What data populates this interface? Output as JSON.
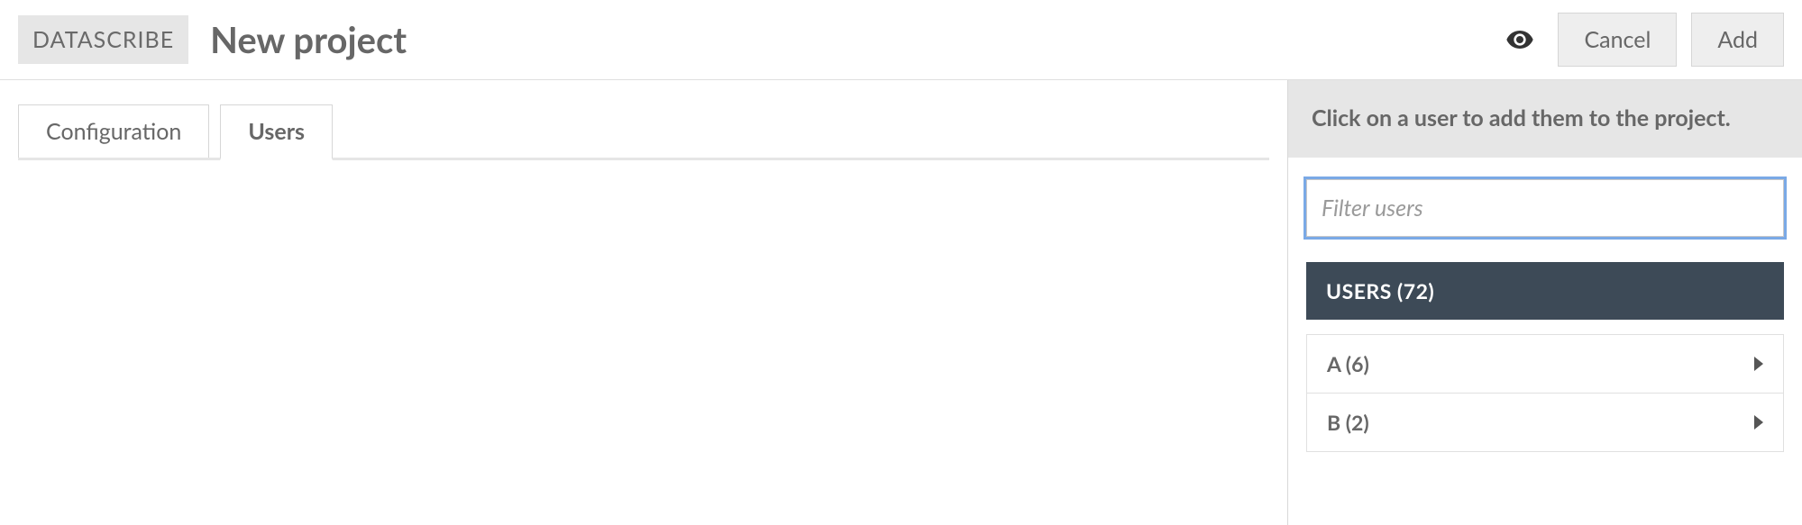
{
  "header": {
    "badge": "DATASCRIBE",
    "title": "New project",
    "cancel_label": "Cancel",
    "add_label": "Add"
  },
  "tabs": {
    "configuration": "Configuration",
    "users": "Users",
    "active": "users"
  },
  "sidebar": {
    "hint": "Click on a user to add them to the project.",
    "filter_placeholder": "Filter users",
    "users_header": "USERS (72)",
    "groups": [
      {
        "label": "A (6)"
      },
      {
        "label": "B (2)"
      }
    ]
  }
}
